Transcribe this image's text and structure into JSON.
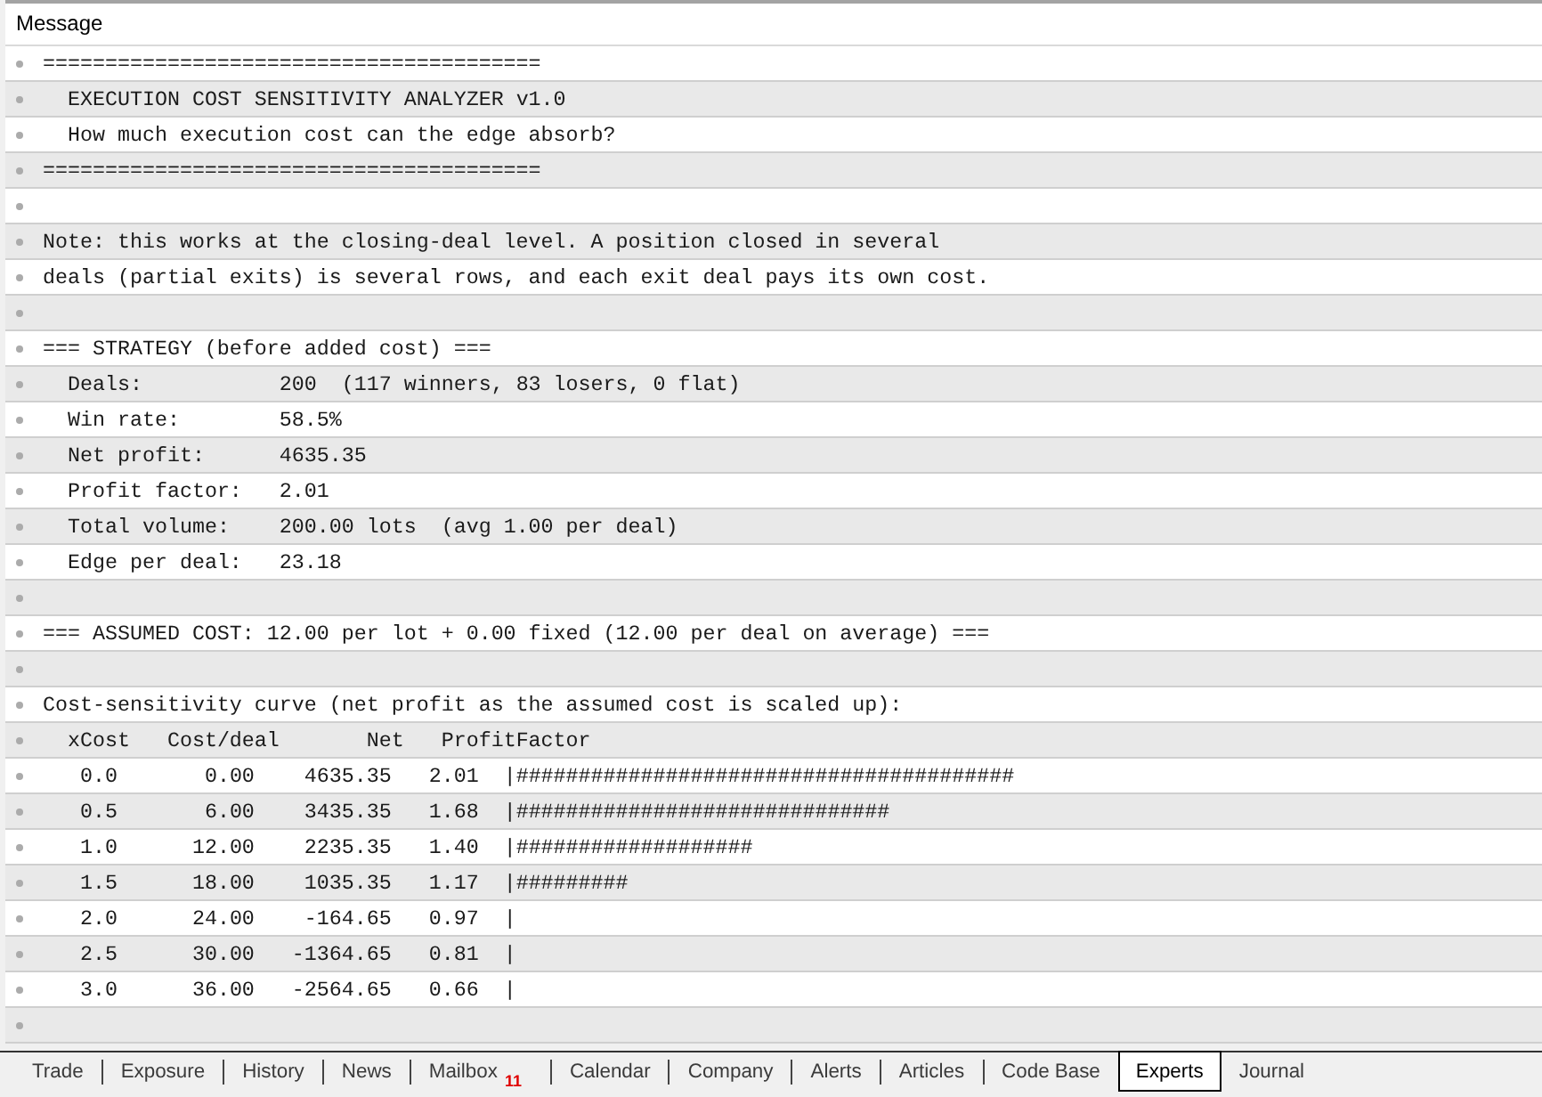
{
  "log": {
    "column": "Message",
    "rows": [
      {
        "kind": "message",
        "text": "========================================"
      },
      {
        "kind": "message",
        "text": "  EXECUTION COST SENSITIVITY ANALYZER v1.0"
      },
      {
        "kind": "message",
        "text": "  How much execution cost can the edge absorb?"
      },
      {
        "kind": "message",
        "text": "========================================"
      },
      {
        "kind": "blank"
      },
      {
        "kind": "message",
        "text": "Note: this works at the closing-deal level. A position closed in several"
      },
      {
        "kind": "message",
        "text": "deals (partial exits) is several rows, and each exit deal pays its own cost."
      },
      {
        "kind": "blank"
      },
      {
        "kind": "message",
        "text": "=== STRATEGY (before added cost) ==="
      },
      {
        "kind": "message",
        "text": "  Deals:           200  (117 winners, 83 losers, 0 flat)"
      },
      {
        "kind": "message",
        "text": "  Win rate:        58.5%"
      },
      {
        "kind": "message",
        "text": "  Net profit:      4635.35"
      },
      {
        "kind": "message",
        "text": "  Profit factor:   2.01"
      },
      {
        "kind": "message",
        "text": "  Total volume:    200.00 lots  (avg 1.00 per deal)"
      },
      {
        "kind": "message",
        "text": "  Edge per deal:   23.18"
      },
      {
        "kind": "blank"
      },
      {
        "kind": "message",
        "text": "=== ASSUMED COST: 12.00 per lot + 0.00 fixed (12.00 per deal on average) ==="
      },
      {
        "kind": "blank"
      },
      {
        "kind": "message",
        "text": "Cost-sensitivity curve (net profit as the assumed cost is scaled up):"
      },
      {
        "kind": "message",
        "text": "  xCost   Cost/deal       Net   ProfitFactor"
      },
      {
        "kind": "message",
        "text": "   0.0       0.00    4635.35   2.01  |########################################"
      },
      {
        "kind": "message",
        "text": "   0.5       6.00    3435.35   1.68  |##############################"
      },
      {
        "kind": "message",
        "text": "   1.0      12.00    2235.35   1.40  |###################"
      },
      {
        "kind": "message",
        "text": "   1.5      18.00    1035.35   1.17  |#########"
      },
      {
        "kind": "message",
        "text": "   2.0      24.00    -164.65   0.97  |"
      },
      {
        "kind": "message",
        "text": "   2.5      30.00   -1364.65   0.81  |"
      },
      {
        "kind": "message",
        "text": "   3.0      36.00   -2564.65   0.66  |"
      },
      {
        "kind": "blank"
      }
    ]
  },
  "tabs": [
    {
      "label": "Trade",
      "selected": false
    },
    {
      "label": "Exposure",
      "selected": false
    },
    {
      "label": "History",
      "selected": false
    },
    {
      "label": "News",
      "selected": false
    },
    {
      "label": "Mailbox",
      "badge": "11",
      "selected": false
    },
    {
      "label": "Calendar",
      "selected": false
    },
    {
      "label": "Company",
      "selected": false
    },
    {
      "label": "Alerts",
      "selected": false
    },
    {
      "label": "Articles",
      "selected": false
    },
    {
      "label": "Code Base",
      "selected": false
    },
    {
      "label": "Experts",
      "selected": true
    },
    {
      "label": "Journal",
      "selected": false
    }
  ]
}
